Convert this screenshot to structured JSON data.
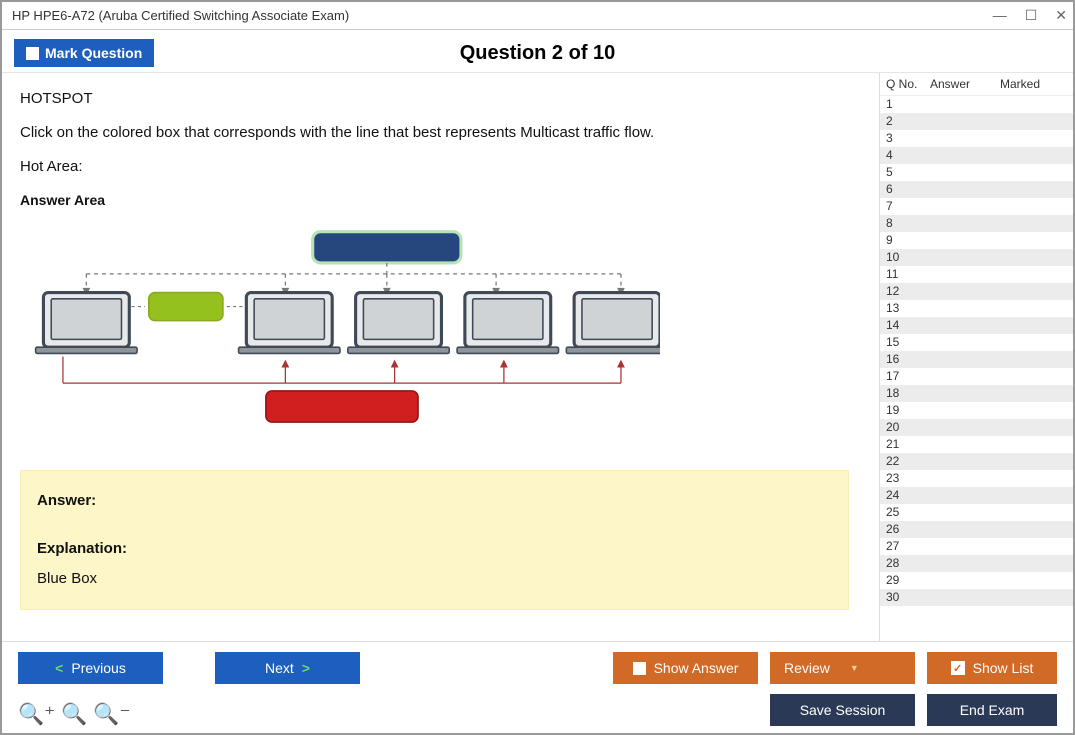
{
  "window": {
    "title": "HP HPE6-A72 (Aruba Certified Switching Associate Exam)"
  },
  "toolbar": {
    "mark_label": "Mark Question",
    "question_header": "Question 2 of 10"
  },
  "question": {
    "type_label": "HOTSPOT",
    "prompt": "Click on the colored box that corresponds with the line that best represents Multicast traffic flow.",
    "hot_area_label": "Hot Area:",
    "answer_area_label": "Answer Area"
  },
  "answer_box": {
    "answer_label": "Answer:",
    "explanation_label": "Explanation:",
    "explanation_text": "Blue Box"
  },
  "side": {
    "header": {
      "qno": "Q No.",
      "answer": "Answer",
      "marked": "Marked"
    },
    "rows": [
      "1",
      "2",
      "3",
      "4",
      "5",
      "6",
      "7",
      "8",
      "9",
      "10",
      "11",
      "12",
      "13",
      "14",
      "15",
      "16",
      "17",
      "18",
      "19",
      "20",
      "21",
      "22",
      "23",
      "24",
      "25",
      "26",
      "27",
      "28",
      "29",
      "30"
    ]
  },
  "footer": {
    "previous": "Previous",
    "next": "Next",
    "show_answer": "Show Answer",
    "review": "Review",
    "show_list": "Show List",
    "save_session": "Save Session",
    "end_exam": "End Exam"
  }
}
